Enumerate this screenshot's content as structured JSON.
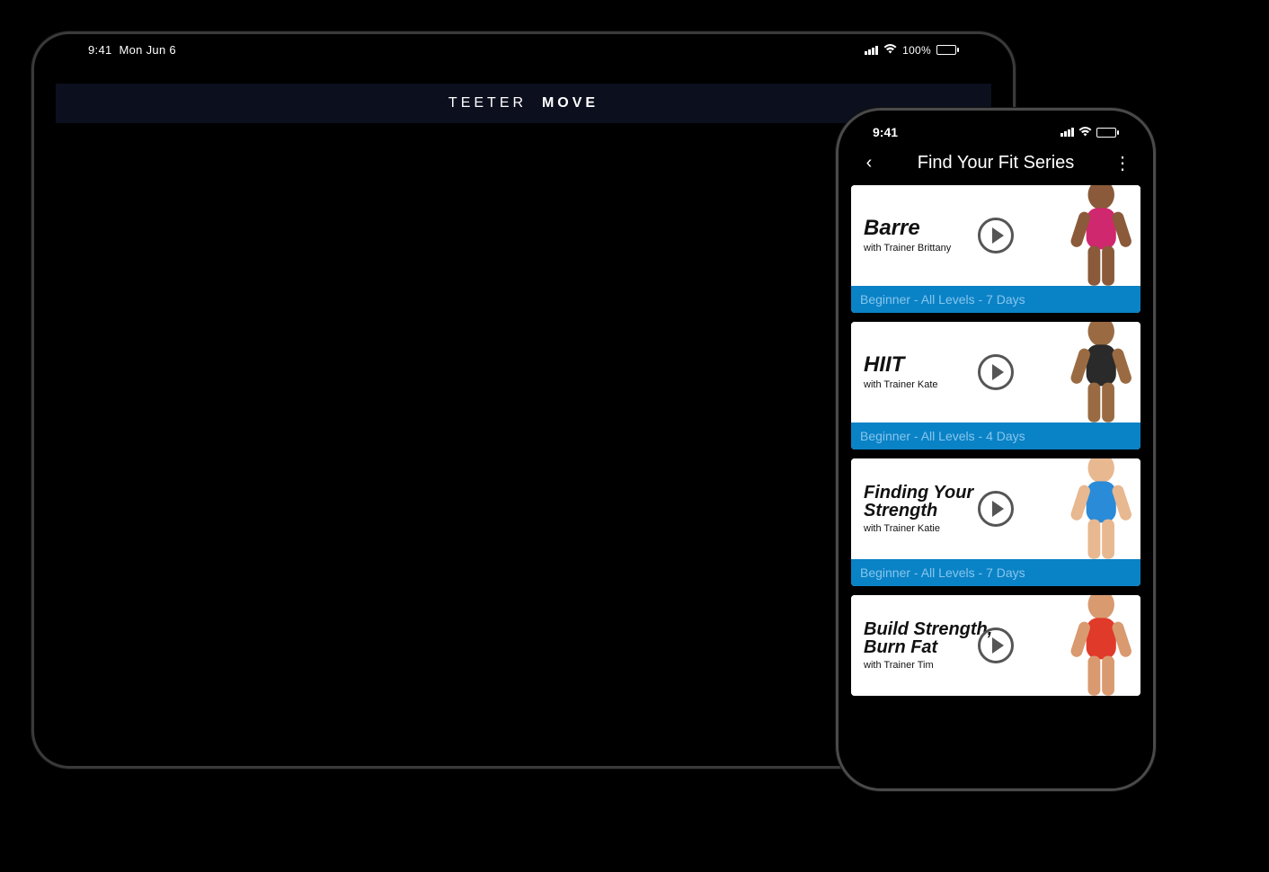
{
  "tablet": {
    "status": {
      "time": "9:41",
      "date": "Mon Jun 6",
      "battery_pct": "100%"
    },
    "header_brand_light": "TEETER",
    "header_brand_bold": "MOVE"
  },
  "phone": {
    "status": {
      "time": "9:41"
    },
    "nav": {
      "back_icon": "‹",
      "title": "Find Your Fit Series",
      "more_icon": "⋮"
    },
    "series": [
      {
        "title": "Barre",
        "trainer": "with Trainer Brittany",
        "meta": "Beginner - All Levels - 7 Days",
        "skin": "#8a5a3a",
        "outfit": "#d0286f",
        "hair": "#1a1a1a"
      },
      {
        "title": "HIIT",
        "trainer": "with Trainer Kate",
        "meta": "Beginner - All Levels - 4 Days",
        "skin": "#9a6b42",
        "outfit": "#2a2a2a",
        "hair": "#8a6a42"
      },
      {
        "title": "Finding Your Strength",
        "trainer": "with Trainer Katie",
        "meta": "Beginner - All Levels - 7 Days",
        "skin": "#e8b890",
        "outfit": "#2a8bd8",
        "hair": "#caa25a"
      },
      {
        "title": "Build Strength, Burn Fat",
        "trainer": "with Trainer Tim",
        "meta": "",
        "skin": "#d99a70",
        "outfit": "#e03a2a",
        "hair": "#3a2a1a"
      }
    ]
  }
}
